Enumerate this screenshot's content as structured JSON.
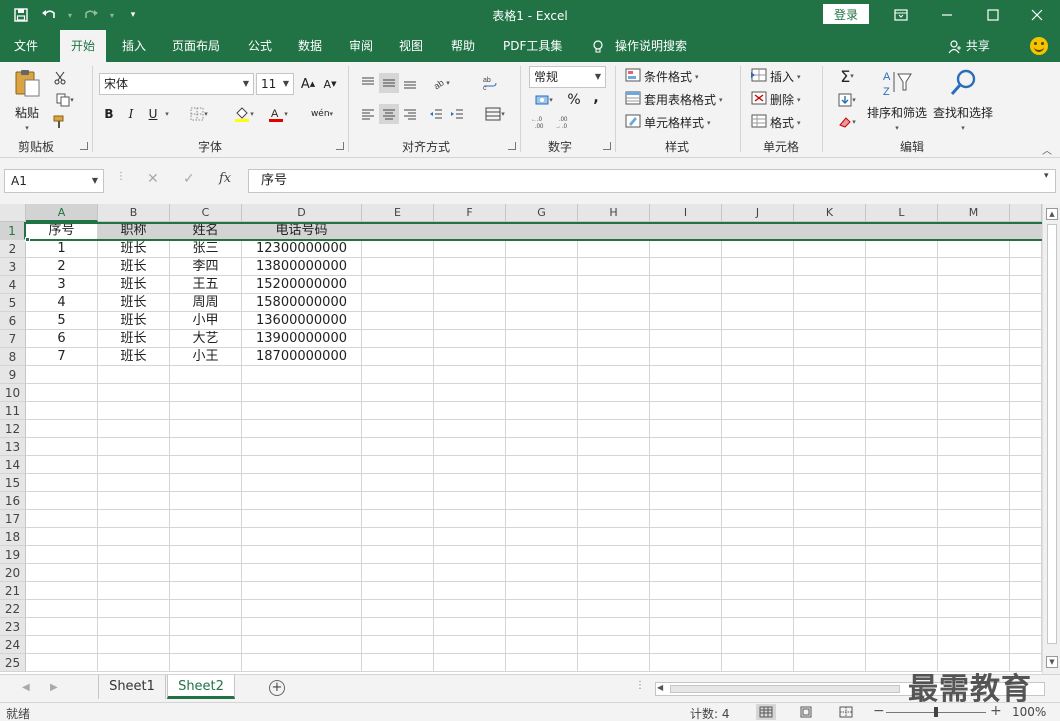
{
  "titlebar": {
    "title": "表格1  -  Excel",
    "login_label": "登录",
    "qat_icons": [
      "save-icon",
      "undo-icon",
      "redo-icon",
      "customize-icon"
    ],
    "bg_color": "#217346"
  },
  "tabs": [
    {
      "label": "文件"
    },
    {
      "label": "开始"
    },
    {
      "label": "插入"
    },
    {
      "label": "页面布局"
    },
    {
      "label": "公式"
    },
    {
      "label": "数据"
    },
    {
      "label": "审阅"
    },
    {
      "label": "视图"
    },
    {
      "label": "帮助"
    },
    {
      "label": "PDF工具集"
    },
    {
      "label": "操作说明搜索"
    }
  ],
  "share_label": "共享",
  "ribbon": {
    "clipboard": {
      "paste_label": "粘贴",
      "group_label": "剪贴板"
    },
    "font": {
      "font_name": "宋体",
      "font_size": "11",
      "group_label": "字体",
      "grow": "A",
      "shrink": "A",
      "bold": "B",
      "italic": "I",
      "underline": "U",
      "phonetic": "wén"
    },
    "alignment": {
      "group_label": "对齐方式"
    },
    "number": {
      "format": "常规",
      "percent": "%",
      "comma": ",",
      "group_label": "数字"
    },
    "styles": {
      "conditional": "条件格式",
      "table": "套用表格格式",
      "cell_styles": "单元格样式",
      "group_label": "样式"
    },
    "cells": {
      "insert": "插入",
      "delete": "删除",
      "format": "格式",
      "group_label": "单元格"
    },
    "editing": {
      "sort_filter": "排序和筛选",
      "find_select": "查找和选择",
      "group_label": "编辑"
    }
  },
  "formula_bar": {
    "name_box": "A1",
    "fx": "fx",
    "content": "序号"
  },
  "sheet": {
    "columns": [
      "A",
      "B",
      "C",
      "D",
      "E",
      "F",
      "G",
      "H",
      "I",
      "J",
      "K",
      "L",
      "M"
    ],
    "row_numbers": [
      "1",
      "2",
      "3",
      "4",
      "5",
      "6",
      "7",
      "8",
      "9",
      "10",
      "11",
      "12",
      "13",
      "14",
      "15",
      "16",
      "17",
      "18",
      "19",
      "20",
      "21",
      "22",
      "23",
      "24",
      "25"
    ],
    "header": [
      "序号",
      "职称",
      "姓名",
      "电话号码"
    ],
    "rows": [
      [
        "1",
        "班长",
        "张三",
        "12300000000"
      ],
      [
        "2",
        "班长",
        "李四",
        "13800000000"
      ],
      [
        "3",
        "班长",
        "王五",
        "15200000000"
      ],
      [
        "4",
        "班长",
        "周周",
        "15800000000"
      ],
      [
        "5",
        "班长",
        "小甲",
        "13600000000"
      ],
      [
        "6",
        "班长",
        "大艺",
        "13900000000"
      ],
      [
        "7",
        "班长",
        "小王",
        "18700000000"
      ]
    ],
    "selected_row": "1",
    "active_cell": "A1"
  },
  "sheet_tabs": [
    {
      "label": "Sheet1"
    },
    {
      "label": "Sheet2"
    }
  ],
  "active_sheet": "Sheet2",
  "status": {
    "ready": "就绪",
    "count": "计数: 4",
    "zoom": "100%",
    "zoom_percent": 100
  },
  "watermark": "最需教育"
}
